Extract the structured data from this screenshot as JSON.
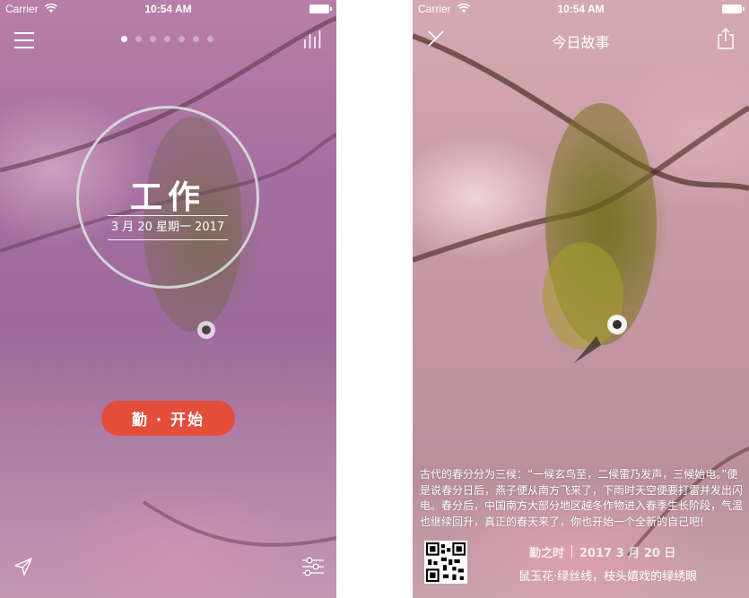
{
  "status_bar": {
    "carrier": "Carrier",
    "time": "10:54 AM"
  },
  "left_screen": {
    "page_dots": {
      "count": 7,
      "active_index": 0
    },
    "title": "工作",
    "date_line": "3 月 20 星期一 2017",
    "start_button_label": "勤 · 开始",
    "icons": [
      "menu-icon",
      "stats-icon",
      "send-icon",
      "settings-sliders-icon"
    ]
  },
  "right_screen": {
    "nav_title": "今日故事",
    "story": "古代的春分分为三候：“一候玄鸟至，二候雷乃发声，三候始电。”便是说春分日后，燕子便从南方飞来了，下雨时天空便要打雷并发出闪电。春分后，中国南方大部分地区越冬作物进入春季生长阶段，气温也继续回升，真正的春天来了，你也开始一个全新的自己吧!",
    "footer_app_name": "勤之时",
    "footer_date": "2017 3 月 20 日",
    "caption": "鼠玉花·绿丝线，枝头嬉戏的绿绣眼",
    "icons": [
      "close-icon",
      "share-icon",
      "qr-code"
    ]
  },
  "colors": {
    "accent_button": "#e44d3a",
    "circle_stroke": "#dce6e1",
    "text": "#ffffff"
  }
}
